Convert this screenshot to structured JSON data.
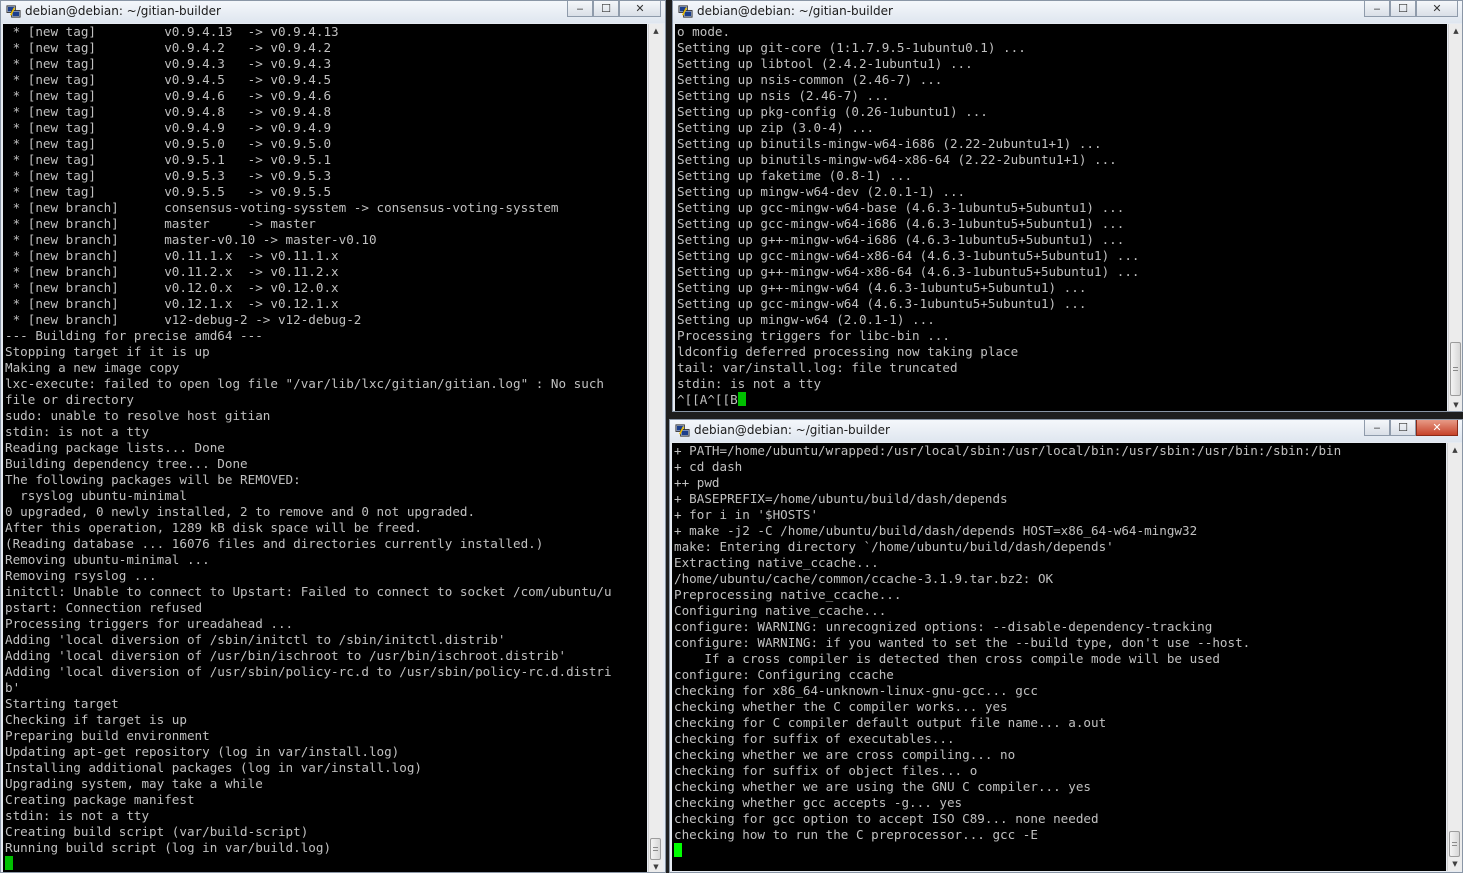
{
  "windows": [
    {
      "title": "debian@debian: ~/gitian-builder",
      "cursor_color": "#00c000",
      "lines": [
        " * [new tag]         v0.9.4.13  -> v0.9.4.13",
        " * [new tag]         v0.9.4.2   -> v0.9.4.2",
        " * [new tag]         v0.9.4.3   -> v0.9.4.3",
        " * [new tag]         v0.9.4.5   -> v0.9.4.5",
        " * [new tag]         v0.9.4.6   -> v0.9.4.6",
        " * [new tag]         v0.9.4.8   -> v0.9.4.8",
        " * [new tag]         v0.9.4.9   -> v0.9.4.9",
        " * [new tag]         v0.9.5.0   -> v0.9.5.0",
        " * [new tag]         v0.9.5.1   -> v0.9.5.1",
        " * [new tag]         v0.9.5.3   -> v0.9.5.3",
        " * [new tag]         v0.9.5.5   -> v0.9.5.5",
        " * [new branch]      consensus-voting-sysstem -> consensus-voting-sysstem",
        " * [new branch]      master     -> master",
        " * [new branch]      master-v0.10 -> master-v0.10",
        " * [new branch]      v0.11.1.x  -> v0.11.1.x",
        " * [new branch]      v0.11.2.x  -> v0.11.2.x",
        " * [new branch]      v0.12.0.x  -> v0.12.0.x",
        " * [new branch]      v0.12.1.x  -> v0.12.1.x",
        " * [new branch]      v12-debug-2 -> v12-debug-2",
        "--- Building for precise amd64 ---",
        "Stopping target if it is up",
        "Making a new image copy",
        "lxc-execute: failed to open log file \"/var/lib/lxc/gitian/gitian.log\" : No such",
        "file or directory",
        "sudo: unable to resolve host gitian",
        "stdin: is not a tty",
        "Reading package lists... Done",
        "Building dependency tree... Done",
        "The following packages will be REMOVED:",
        "  rsyslog ubuntu-minimal",
        "0 upgraded, 0 newly installed, 2 to remove and 0 not upgraded.",
        "After this operation, 1289 kB disk space will be freed.",
        "(Reading database ... 16076 files and directories currently installed.)",
        "Removing ubuntu-minimal ...",
        "Removing rsyslog ...",
        "initctl: Unable to connect to Upstart: Failed to connect to socket /com/ubuntu/u",
        "pstart: Connection refused",
        "Processing triggers for ureadahead ...",
        "Adding 'local diversion of /sbin/initctl to /sbin/initctl.distrib'",
        "Adding 'local diversion of /usr/bin/ischroot to /usr/bin/ischroot.distrib'",
        "Adding 'local diversion of /usr/sbin/policy-rc.d to /usr/sbin/policy-rc.d.distri",
        "b'",
        "Starting target",
        "Checking if target is up",
        "Preparing build environment",
        "Updating apt-get repository (log in var/install.log)",
        "Installing additional packages (log in var/install.log)",
        "Upgrading system, may take a while",
        "Creating package manifest",
        "stdin: is not a tty",
        "Creating build script (var/build-script)",
        "Running build script (log in var/build.log)",
        ""
      ]
    },
    {
      "title": "debian@debian: ~/gitian-builder",
      "cursor_color": "#00c000",
      "lines": [
        "o mode.",
        "Setting up git-core (1:1.7.9.5-1ubuntu0.1) ...",
        "Setting up libtool (2.4.2-1ubuntu1) ...",
        "Setting up nsis-common (2.46-7) ...",
        "Setting up nsis (2.46-7) ...",
        "Setting up pkg-config (0.26-1ubuntu1) ...",
        "Setting up zip (3.0-4) ...",
        "Setting up binutils-mingw-w64-i686 (2.22-2ubuntu1+1) ...",
        "Setting up binutils-mingw-w64-x86-64 (2.22-2ubuntu1+1) ...",
        "Setting up faketime (0.8-1) ...",
        "Setting up mingw-w64-dev (2.0.1-1) ...",
        "Setting up gcc-mingw-w64-base (4.6.3-1ubuntu5+5ubuntu1) ...",
        "Setting up gcc-mingw-w64-i686 (4.6.3-1ubuntu5+5ubuntu1) ...",
        "Setting up g++-mingw-w64-i686 (4.6.3-1ubuntu5+5ubuntu1) ...",
        "Setting up gcc-mingw-w64-x86-64 (4.6.3-1ubuntu5+5ubuntu1) ...",
        "Setting up g++-mingw-w64-x86-64 (4.6.3-1ubuntu5+5ubuntu1) ...",
        "Setting up g++-mingw-w64 (4.6.3-1ubuntu5+5ubuntu1) ...",
        "Setting up gcc-mingw-w64 (4.6.3-1ubuntu5+5ubuntu1) ...",
        "Setting up mingw-w64 (2.0.1-1) ...",
        "Processing triggers for libc-bin ...",
        "ldconfig deferred processing now taking place",
        "tail: var/install.log: file truncated",
        "stdin: is not a tty",
        "^[[A^[[B"
      ]
    },
    {
      "title": "debian@debian: ~/gitian-builder",
      "cursor_color": "#00ff00",
      "lines": [
        "+ PATH=/home/ubuntu/wrapped:/usr/local/sbin:/usr/local/bin:/usr/sbin:/usr/bin:/sbin:/bin",
        "+ cd dash",
        "++ pwd",
        "+ BASEPREFIX=/home/ubuntu/build/dash/depends",
        "+ for i in '$HOSTS'",
        "+ make -j2 -C /home/ubuntu/build/dash/depends HOST=x86_64-w64-mingw32",
        "make: Entering directory `/home/ubuntu/build/dash/depends'",
        "Extracting native_ccache...",
        "/home/ubuntu/cache/common/ccache-3.1.9.tar.bz2: OK",
        "Preprocessing native_ccache...",
        "Configuring native_ccache...",
        "configure: WARNING: unrecognized options: --disable-dependency-tracking",
        "configure: WARNING: if you wanted to set the --build type, don't use --host.",
        "    If a cross compiler is detected then cross compile mode will be used",
        "configure: Configuring ccache",
        "checking for x86_64-unknown-linux-gnu-gcc... gcc",
        "checking whether the C compiler works... yes",
        "checking for C compiler default output file name... a.out",
        "checking for suffix of executables...",
        "checking whether we are cross compiling... no",
        "checking for suffix of object files... o",
        "checking whether we are using the GNU C compiler... yes",
        "checking whether gcc accepts -g... yes",
        "checking for gcc option to accept ISO C89... none needed",
        "checking how to run the C preprocessor... gcc -E",
        ""
      ]
    }
  ],
  "controls": {
    "minimize": "‒",
    "maximize": "☐",
    "close": "✕"
  },
  "colors": {
    "terminal_bg": "#000000",
    "terminal_fg": "#c0c0c0"
  }
}
